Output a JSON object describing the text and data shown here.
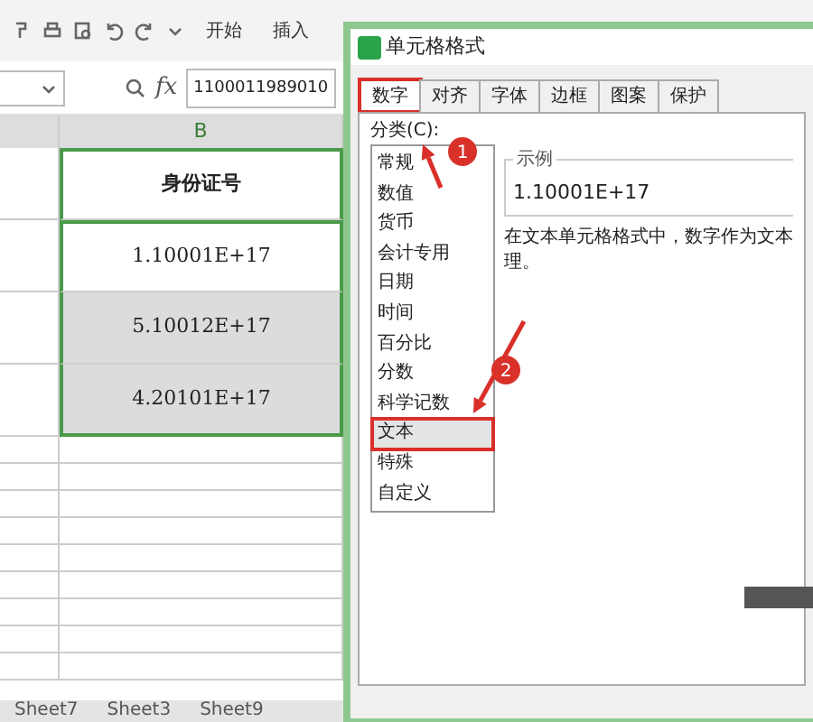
{
  "toolbar": {
    "menu": [
      "开始",
      "插入"
    ]
  },
  "formula_bar": {
    "fx": "fx",
    "value": "1100011989010"
  },
  "sheet": {
    "column": "B",
    "header": "身份证号",
    "rows": [
      {
        "value": "1.10001E+17",
        "active": true
      },
      {
        "value": "5.10012E+17",
        "active": false
      },
      {
        "value": "4.20101E+17",
        "active": false
      }
    ],
    "tabs": [
      "Sheet7",
      "Sheet3",
      "Sheet9"
    ]
  },
  "dialog": {
    "title": "单元格格式",
    "tabs": [
      {
        "label": "数字",
        "selected": true
      },
      {
        "label": "对齐",
        "selected": false
      },
      {
        "label": "字体",
        "selected": false
      },
      {
        "label": "边框",
        "selected": false
      },
      {
        "label": "图案",
        "selected": false
      },
      {
        "label": "保护",
        "selected": false
      }
    ],
    "category_label": "分类(C):",
    "categories": [
      {
        "label": "常规",
        "selected": false
      },
      {
        "label": "数值",
        "selected": false
      },
      {
        "label": "货币",
        "selected": false
      },
      {
        "label": "会计专用",
        "selected": false
      },
      {
        "label": "日期",
        "selected": false
      },
      {
        "label": "时间",
        "selected": false
      },
      {
        "label": "百分比",
        "selected": false
      },
      {
        "label": "分数",
        "selected": false
      },
      {
        "label": "科学记数",
        "selected": false
      },
      {
        "label": "文本",
        "selected": true
      },
      {
        "label": "特殊",
        "selected": false
      },
      {
        "label": "自定义",
        "selected": false
      }
    ],
    "sample_label": "示例",
    "sample": "1.10001E+17",
    "description": [
      "在文本单元格格式中，数字作为文本",
      "理。"
    ]
  },
  "annotations": [
    {
      "number": "1"
    },
    {
      "number": "2"
    }
  ]
}
